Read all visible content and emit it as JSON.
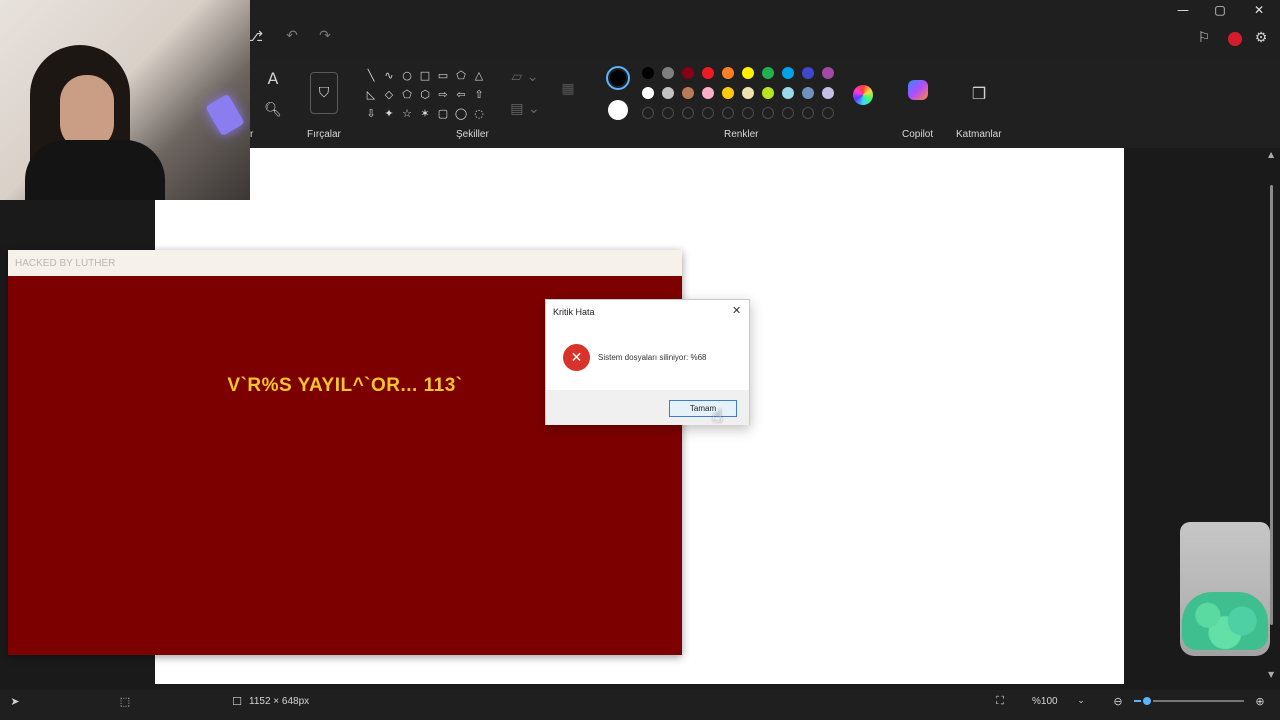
{
  "ribbon": {
    "groups": {
      "brushes": "Fırçalar",
      "shapes": "Şekiller",
      "colors": "Renkler",
      "copilot": "Copilot",
      "layers": "Katmanlar"
    },
    "cut_label": "r"
  },
  "shapes": [
    "╲",
    "∿",
    "○",
    "□",
    "▭",
    "⬠",
    "△",
    "◺",
    "◇",
    "⬠",
    "⬡",
    "⇨",
    "⇦",
    "⇧",
    "⇩",
    "✦",
    "☆",
    "✶",
    "▢",
    "◯",
    "◌"
  ],
  "colors": {
    "primary": "#000000",
    "secondary": "#ffffff",
    "palette_row1": [
      "#000000",
      "#7f7f7f",
      "#880015",
      "#ed1c24",
      "#ff7f27",
      "#fff200",
      "#22b14c",
      "#00a2e8",
      "#3f48cc",
      "#a349a4"
    ],
    "palette_row2": [
      "#ffffff",
      "#c3c3c3",
      "#b97a57",
      "#ffaec9",
      "#ffc90e",
      "#efe4b0",
      "#b5e61d",
      "#99d9ea",
      "#7092be",
      "#c8bfe7"
    ],
    "palette_row3_empty_count": 10
  },
  "hack_window": {
    "title": "HACKED BY LUTHER",
    "message": "V`R%S YAYIL^`OR... 113`",
    "background": "#7d0000",
    "text_color": "#f4c62a"
  },
  "dialog": {
    "title": "Kritik Hata",
    "message": "Sistem dosyaları siliniyor: %68",
    "ok_label": "Tamam"
  },
  "statusbar": {
    "canvas_size": "1152 × 648px",
    "zoom": "%100",
    "zoom_slider_fraction": 0.12
  }
}
